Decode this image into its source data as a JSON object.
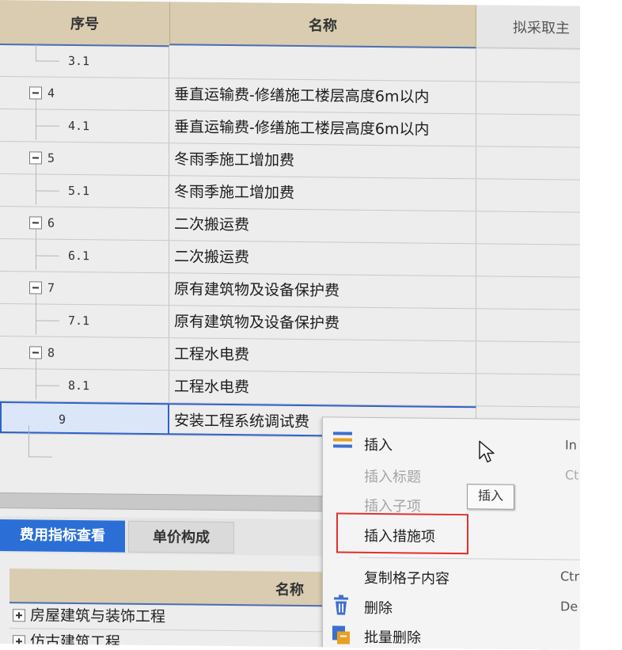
{
  "grid": {
    "headers": {
      "seq": "序号",
      "name": "名称",
      "plan": "拟采取主"
    },
    "rows": [
      {
        "code": "3.1",
        "name": "",
        "level": 2,
        "expanded": false
      },
      {
        "code": "4",
        "name": "垂直运输费-修缮施工楼层高度6m以内",
        "level": 1,
        "expanded": true
      },
      {
        "code": "4.1",
        "name": "垂直运输费-修缮施工楼层高度6m以内",
        "level": 2,
        "expanded": false
      },
      {
        "code": "5",
        "name": "冬雨季施工增加费",
        "level": 1,
        "expanded": true
      },
      {
        "code": "5.1",
        "name": "冬雨季施工增加费",
        "level": 2,
        "expanded": false
      },
      {
        "code": "6",
        "name": "二次搬运费",
        "level": 1,
        "expanded": true
      },
      {
        "code": "6.1",
        "name": "二次搬运费",
        "level": 2,
        "expanded": false
      },
      {
        "code": "7",
        "name": "原有建筑物及设备保护费",
        "level": 1,
        "expanded": true
      },
      {
        "code": "7.1",
        "name": "原有建筑物及设备保护费",
        "level": 2,
        "expanded": false
      },
      {
        "code": "8",
        "name": "工程水电费",
        "level": 1,
        "expanded": true
      },
      {
        "code": "8.1",
        "name": "工程水电费",
        "level": 2,
        "expanded": false
      },
      {
        "code": "9",
        "name": "安装工程系统调试费",
        "level": 1,
        "expanded": false,
        "selected": true
      }
    ]
  },
  "tabs": [
    {
      "label": "费用指标查看",
      "active": true
    },
    {
      "label": "单价构成",
      "active": false
    }
  ],
  "bottom": {
    "header": "名称",
    "rows": [
      "房屋建筑与装饰工程",
      "仿古建筑工程"
    ]
  },
  "context_menu": {
    "items": [
      {
        "label": "插入",
        "shortcut": "In",
        "disabled": false,
        "icon": "insert-rows-icon"
      },
      {
        "label": "插入标题",
        "shortcut": "Ct",
        "disabled": true,
        "icon": ""
      },
      {
        "label": "插入子项",
        "shortcut": "",
        "disabled": true,
        "icon": ""
      },
      {
        "label": "插入措施项",
        "shortcut": "",
        "disabled": false,
        "icon": "",
        "highlighted": true
      },
      {
        "label": "复制格子内容",
        "shortcut": "Ctr",
        "disabled": false,
        "icon": ""
      },
      {
        "label": "删除",
        "shortcut": "De",
        "disabled": false,
        "icon": "trash-icon"
      },
      {
        "label": "批量删除",
        "shortcut": "",
        "disabled": false,
        "icon": "batch-delete-icon"
      }
    ],
    "tooltip": "插入"
  },
  "colors": {
    "header_bg": "#d9ccb0",
    "selection_border": "#2e62c8",
    "active_tab": "#2b6fd6",
    "highlight_box": "#e0312b"
  }
}
